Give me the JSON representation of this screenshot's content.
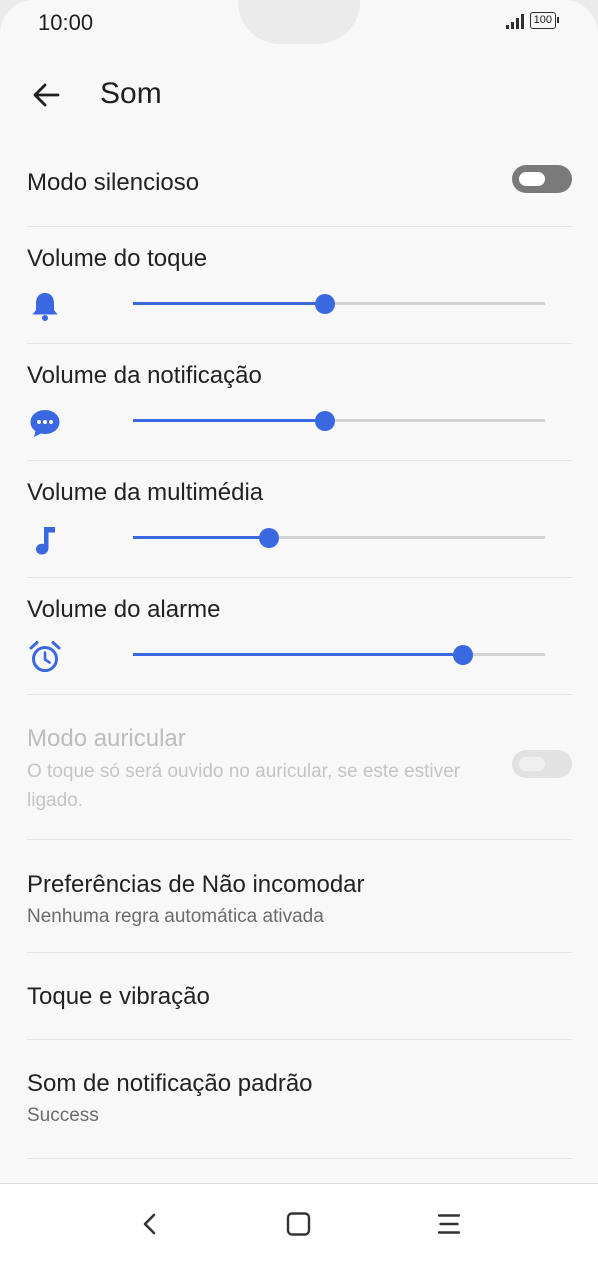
{
  "status_bar": {
    "time": "10:00",
    "battery": "100"
  },
  "header": {
    "title": "Som"
  },
  "silent_mode": {
    "label": "Modo silencioso",
    "enabled": false
  },
  "volumes": [
    {
      "label": "Volume do toque",
      "icon": "bell-icon",
      "level": 0.465
    },
    {
      "label": "Volume da notificação",
      "icon": "chat-bubble-icon",
      "level": 0.465
    },
    {
      "label": "Volume da multimédia",
      "icon": "music-note-icon",
      "level": 0.33
    },
    {
      "label": "Volume do alarme",
      "icon": "alarm-clock-icon",
      "level": 0.8
    }
  ],
  "earpiece_mode": {
    "label": "Modo auricular",
    "description": "O toque só será ouvido no auricular, se este estiver ligado.",
    "enabled": false,
    "disabled": true
  },
  "do_not_disturb": {
    "label": "Preferências de Não incomodar",
    "summary": "Nenhuma regra automática ativada"
  },
  "ringtone_vibration": {
    "label": "Toque e vibração"
  },
  "default_notification_sound": {
    "label": "Som de notificação padrão",
    "value": "Success"
  },
  "colors": {
    "accent": "#3a68e0",
    "toggle_off": "#7a7a7a",
    "background": "#f8f8f8"
  },
  "nav_bar": {
    "icons": [
      "back-icon",
      "home-icon",
      "menu-icon"
    ]
  }
}
